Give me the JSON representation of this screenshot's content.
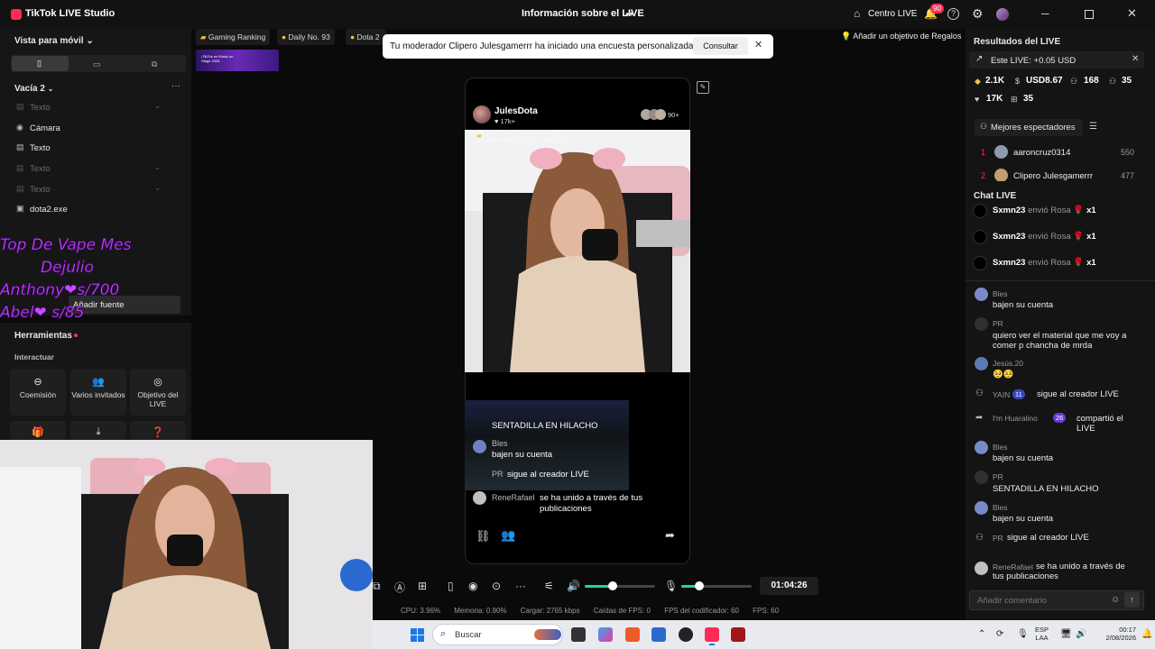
{
  "window": {
    "app_title": "TikTok LIVE Studio",
    "center_title": "Información sobre el LIVE",
    "live_center_label": "Centro LIVE",
    "notification_count": "90"
  },
  "left": {
    "view_mode": "Vista para móvil",
    "scene_name": "Vacía 2",
    "sources": [
      {
        "label": "Texto",
        "dim": true
      },
      {
        "label": "Cámara",
        "dim": false
      },
      {
        "label": "Texto",
        "dim": false
      },
      {
        "label": "Texto",
        "dim": true
      },
      {
        "label": "Texto",
        "dim": true
      },
      {
        "label": "dota2.exe",
        "dim": false
      }
    ],
    "overlay_lines": [
      "Top De Vape  Mes",
      "Dejulio",
      "Anthony❤s/700",
      "Abel❤    s/85"
    ],
    "add_source": "Añadir fuente",
    "tools_title": "Herramientas",
    "interact_title": "Interactuar",
    "tools": [
      {
        "label": "Coemisión",
        "icon": "link-icon"
      },
      {
        "label": "Varios invitados",
        "icon": "guests-icon"
      },
      {
        "label": "Objetivo del LIVE",
        "icon": "target-icon"
      }
    ]
  },
  "top_strip": {
    "chips": [
      "Gaming Ranking",
      "Daily No. 93",
      "Dota 2"
    ],
    "gift_goal": "Añadir un objetivo de Regalos",
    "banner_text": "¡TikTok en Music on Stage 2026"
  },
  "notice": {
    "text": "Tu moderador Clipero Julesgamerrr ha iniciado una encuesta personalizada",
    "button": "Consultar"
  },
  "preview": {
    "host_name": "JulesDota",
    "host_likes": "♥ 17k+",
    "viewers": "90+",
    "rank_pill": "Clasificación de gami...",
    "overlay_chat": [
      {
        "name": "",
        "msg": "SENTADILLA EN HILACHO"
      },
      {
        "name": "Bles",
        "msg": "bajen su cuenta"
      },
      {
        "name": "PR",
        "msg": "sigue al creador LIVE"
      },
      {
        "name": "ReneRafael",
        "msg": "se ha unido a través de tus publicaciones"
      }
    ]
  },
  "toolbar": {
    "timer": "01:04:26",
    "volume_level": 0.4,
    "mic_level": 0.25
  },
  "stats": [
    "CPU: 3.96%",
    "Memoria: 0.90%",
    "Cargar: 2765 kbps",
    "Caídas de FPS: 0",
    "FPS del codificador: 60",
    "FPS: 60"
  ],
  "right": {
    "results_title": "Resultados del LIVE",
    "this_live": "Este LIVE: +0.05 USD",
    "stats_row1": [
      "2.1K",
      "USD8.67",
      "168",
      "35"
    ],
    "stats_row2": [
      "17K",
      "35"
    ],
    "top_viewers_label": "Mejores espectadores",
    "ranking": [
      {
        "rank": "1",
        "name": "aaroncruz0314",
        "score": "550"
      },
      {
        "rank": "2",
        "name": "Clipero Julesgamerrr",
        "score": "477"
      }
    ],
    "chat_title": "Chat LIVE",
    "gifts": [
      {
        "user": "Sxmn23",
        "action": "envió Rosa",
        "mult": "x1"
      },
      {
        "user": "Sxmn23",
        "action": "envió Rosa",
        "mult": "x1"
      },
      {
        "user": "Sxmn23",
        "action": "envió Rosa",
        "mult": "x1"
      }
    ],
    "chat": [
      {
        "name": "Bles",
        "msg": "bajen su cuenta"
      },
      {
        "name": "PR",
        "msg": "quiero ver el material que me voy a comer p chancha de mrda"
      },
      {
        "name": "Jesús.20",
        "msg": "🥺🥺"
      },
      {
        "name": "YAIN",
        "badge": "11",
        "msg": "sigue al creador LIVE"
      },
      {
        "name": "I'm Huaralino",
        "badge": "26",
        "msg": "compartió el LIVE"
      },
      {
        "name": "Bles",
        "msg": "bajen su cuenta"
      },
      {
        "name": "PR",
        "msg": "SENTADILLA EN HILACHO"
      },
      {
        "name": "Bles",
        "msg": "bajen su cuenta"
      },
      {
        "name": "PR",
        "msg": "sigue al creador LIVE"
      },
      {
        "name": "ReneRafael",
        "msg": "se ha unido a través de tus publicaciones"
      }
    ],
    "comment_placeholder": "Añadir comentario"
  },
  "taskbar": {
    "search": "Buscar",
    "lang_line1": "ESP",
    "lang_line2": "LAA",
    "time": "00:17",
    "date": "2/08/2026"
  },
  "colors": {
    "accent": "#fe2c55",
    "slider": "#25d49a",
    "overlay_text": "#c84dff"
  }
}
